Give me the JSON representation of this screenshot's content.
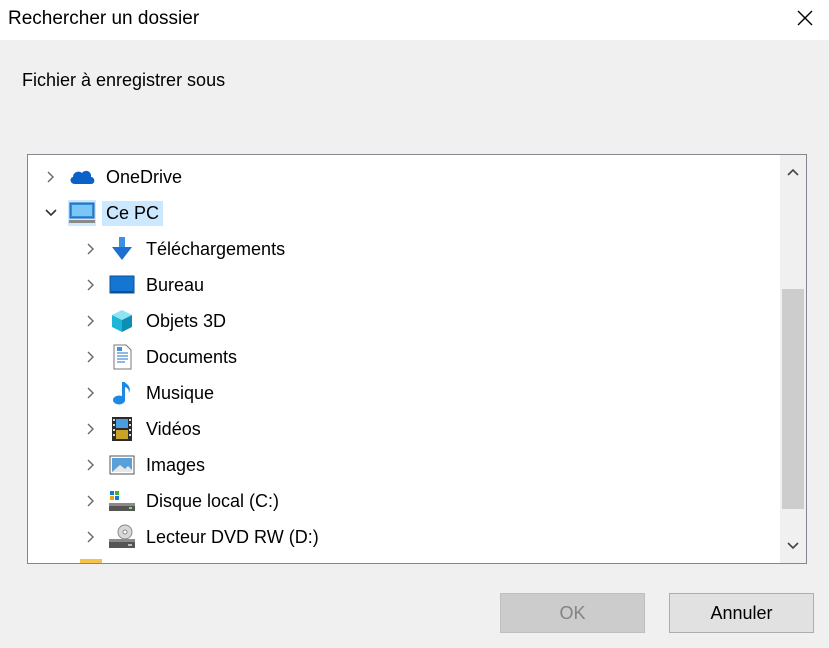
{
  "window": {
    "title": "Rechercher un dossier",
    "close_icon": "close-icon"
  },
  "description": "Fichier à enregistrer sous",
  "tree": {
    "items": [
      {
        "label": "OneDrive",
        "icon": "onedrive-cloud-icon",
        "level": 0,
        "expanded": false,
        "selected": false
      },
      {
        "label": "Ce PC",
        "icon": "computer-icon",
        "level": 0,
        "expanded": true,
        "selected": true
      },
      {
        "label": "Téléchargements",
        "icon": "download-arrow-icon",
        "level": 1,
        "expanded": false,
        "selected": false
      },
      {
        "label": "Bureau",
        "icon": "desktop-icon",
        "level": 1,
        "expanded": false,
        "selected": false
      },
      {
        "label": "Objets 3D",
        "icon": "cube-3d-icon",
        "level": 1,
        "expanded": false,
        "selected": false
      },
      {
        "label": "Documents",
        "icon": "document-icon",
        "level": 1,
        "expanded": false,
        "selected": false
      },
      {
        "label": "Musique",
        "icon": "music-note-icon",
        "level": 1,
        "expanded": false,
        "selected": false
      },
      {
        "label": "Vidéos",
        "icon": "film-icon",
        "level": 1,
        "expanded": false,
        "selected": false
      },
      {
        "label": "Images",
        "icon": "picture-icon",
        "level": 1,
        "expanded": false,
        "selected": false
      },
      {
        "label": "Disque local (C:)",
        "icon": "local-disk-icon",
        "level": 1,
        "expanded": false,
        "selected": false
      },
      {
        "label": "Lecteur DVD RW (D:)",
        "icon": "dvd-drive-icon",
        "level": 1,
        "expanded": false,
        "selected": false
      }
    ]
  },
  "buttons": {
    "ok": "OK",
    "cancel": "Annuler"
  },
  "colors": {
    "selection": "#cce8ff",
    "accent": "#0078d7"
  }
}
